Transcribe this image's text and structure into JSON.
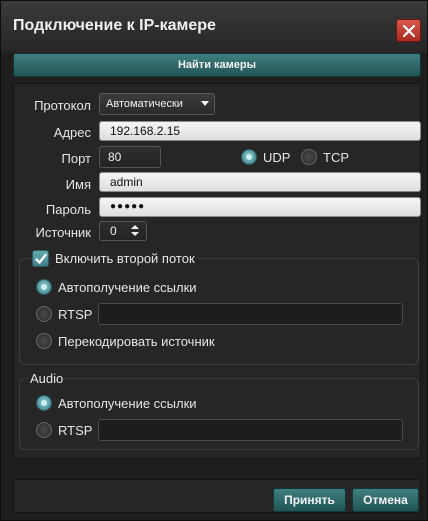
{
  "window": {
    "title": "Подключение к IP-камере",
    "close_icon": "close-icon"
  },
  "find_cameras": {
    "label": "Найти камеры"
  },
  "form": {
    "protocol_label": "Протокол",
    "protocol_value": "Автоматически",
    "address_label": "Адрес",
    "address_value": "192.168.2.15",
    "port_label": "Порт",
    "port_value": "80",
    "transport_options": [
      {
        "label": "UDP",
        "selected": true
      },
      {
        "label": "TCP",
        "selected": false
      }
    ],
    "name_label": "Имя",
    "name_value": "admin",
    "password_label": "Пароль",
    "password_value": "●●●●●",
    "source_label": "Источник",
    "source_value": "0"
  },
  "second_stream": {
    "checkbox_label": "Включить второй поток",
    "checked": true,
    "options": [
      {
        "label": "Автополучение ссылки",
        "selected": true
      },
      {
        "label": "RTSP",
        "selected": false,
        "value": ""
      },
      {
        "label": "Перекодировать источник",
        "selected": false
      }
    ]
  },
  "audio": {
    "title": "Audio",
    "options": [
      {
        "label": "Автополучение ссылки",
        "selected": true
      },
      {
        "label": "RTSP",
        "selected": false,
        "value": ""
      }
    ]
  },
  "buttons": {
    "accept": "Принять",
    "cancel": "Отмена"
  },
  "colors": {
    "accent": "#2f6b6d",
    "close": "#c2392e",
    "background": "#262626"
  }
}
